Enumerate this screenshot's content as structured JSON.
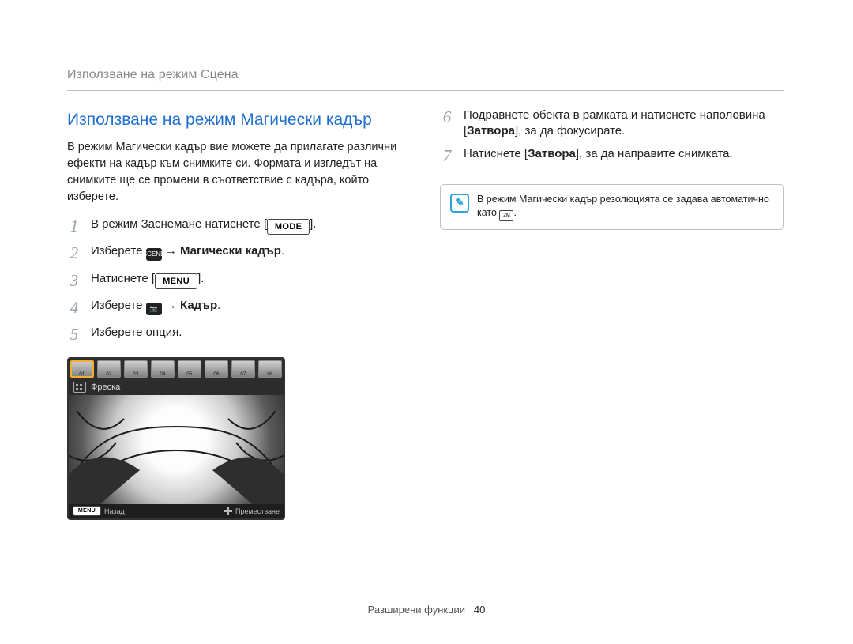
{
  "header": {
    "title": "Използване на режим Сцена"
  },
  "left": {
    "subheading": "Използване на режим Магически кадър",
    "intro": "В режим Магически кадър вие можете да прилагате различни ефекти на кадър към снимките си. Форматa и изгледът на снимките ще се промени в съответствие с кадъра, който изберете.",
    "steps": {
      "1": {
        "pre": "В режим Заснемане натиснете [",
        "badge": "MODE",
        "post": "]."
      },
      "2": {
        "pre": "Изберете ",
        "icon": "scene-icon",
        "arrow": " → ",
        "strong": "Магически кадър",
        "post": "."
      },
      "3": {
        "pre": "Натиснете [",
        "badge": "MENU",
        "post": "]."
      },
      "4": {
        "pre": "Изберете ",
        "icon": "camera-icon",
        "arrow": " → ",
        "strong": "Кадър",
        "post": "."
      },
      "5": {
        "text": "Изберете опция."
      }
    },
    "screenshot": {
      "thumbs": [
        "01",
        "02",
        "03",
        "04",
        "05",
        "06",
        "07",
        "08"
      ],
      "selectedThumb": 0,
      "labelRow": "Фреска",
      "bottomLeftBadge": "MENU",
      "bottomLeft": "Назад",
      "bottomRight": "Преместване"
    }
  },
  "right": {
    "steps": {
      "6": {
        "part1": "Подравнете обекта в рамката и натиснете наполовина [",
        "strong1": "Затвора",
        "part2": "], за да фокусирате."
      },
      "7": {
        "part1": "Натиснете [",
        "strong1": "Затвора",
        "part2": "], за да направите снимката."
      }
    },
    "note": {
      "text": "В режим Магически кадър резолюцията се задава автоматично като ",
      "badge": "2м"
    }
  },
  "footer": {
    "section": "Разширени функции",
    "page": "40"
  }
}
